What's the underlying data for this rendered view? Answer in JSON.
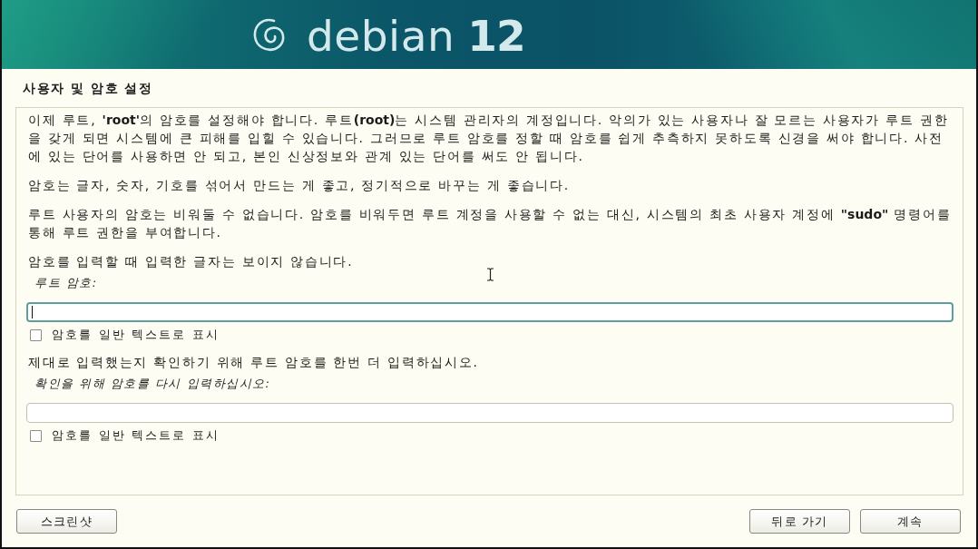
{
  "header": {
    "logo_text": "debian",
    "version": "12"
  },
  "page_title": "사용자 및 암호 설정",
  "content": [
    {
      "kind": "paragraph",
      "text": "이제 루트, **'root'**의 암호를 설정해야 합니다. 루트**(root)**는 시스템 관리자의 계정입니다. 악의가 있는 사용자나 잘 모르는 사용자가 루트 권한을 갖게 되면 시스템에 큰 피해를 입힐 수 있습니다. 그러므로 루트 암호를 정할 때 암호를 쉽게 추측하지 못하도록 신경을 써야 합니다. 사전에 있는 단어를 사용하면 안 되고, 본인 신상정보와 관계 있는 단어를 써도 안 됩니다."
    },
    {
      "kind": "paragraph",
      "text": "암호는 글자, 숫자, 기호를 섞어서 만드는 게 좋고, 정기적으로 바꾸는 게 좋습니다."
    },
    {
      "kind": "paragraph",
      "text": "루트 사용자의 암호는 비워둘 수 없습니다. 암호를 비워두면 루트 계정을 사용할 수 없는 대신, 시스템의 최초 사용자 계정에 **\"sudo\"** 명령어를 통해 루트 권한을 부여합니다."
    },
    {
      "kind": "paragraph",
      "text": "암호를 입력할 때 입력한 글자는 보이지 않습니다."
    },
    {
      "kind": "password",
      "label": "루트 암호:",
      "focused": true,
      "show_text": {
        "label": "암호를 일반 텍스트로 표시",
        "checked": false
      }
    },
    {
      "kind": "paragraph",
      "text": "제대로 입력했는지 확인하기 위해 루트 암호를 한번 더 입력하십시오."
    },
    {
      "kind": "password",
      "label": "확인을 위해 암호를 다시 입력하십시오:",
      "focused": false,
      "show_text": {
        "label": "암호를 일반 텍스트로 표시",
        "checked": false
      }
    }
  ],
  "buttons": {
    "left": [
      {
        "label": "스크린샷"
      }
    ],
    "right": [
      {
        "label": "뒤로 가기"
      },
      {
        "label": "계속"
      }
    ]
  }
}
